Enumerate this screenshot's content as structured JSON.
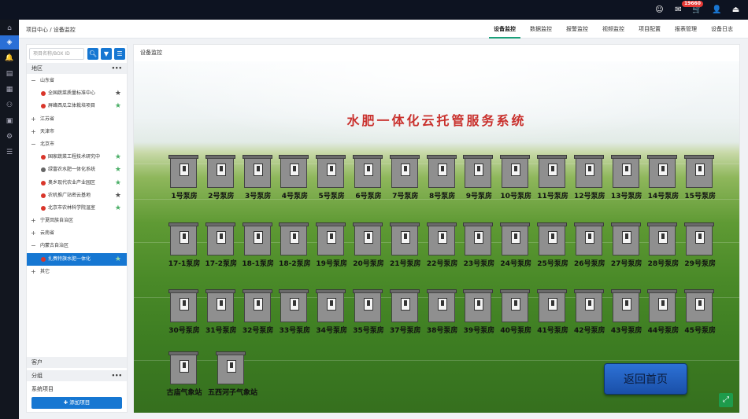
{
  "topbar": {
    "badge": "19660",
    "icons": [
      "smiley-icon",
      "mail-icon",
      "cart-icon",
      "user-icon",
      "logout-icon"
    ]
  },
  "rail": {
    "icons": [
      "home-icon",
      "layers-icon",
      "alert-icon",
      "clipboard-icon",
      "grid-icon",
      "person-icon",
      "bus-icon",
      "settings-icon",
      "database-icon"
    ]
  },
  "header": {
    "breadcrumb": "项目中心 / 设备监控",
    "tabs": [
      "设备监控",
      "数据监控",
      "报警监控",
      "视频监控",
      "项目配置",
      "报表管理",
      "设备日志"
    ],
    "active_tab": "设备监控"
  },
  "sidebar": {
    "search_placeholder": "项目名称/BOX ID",
    "section_region": "地区",
    "more": "•••",
    "tree": [
      {
        "type": "group",
        "toggle": "−",
        "label": "山东省"
      },
      {
        "type": "leaf",
        "label": "全国蔬菜质量标准中心",
        "dot": "#d9362b",
        "star": "#555555"
      },
      {
        "type": "leaf",
        "label": "屏峰西瓜立体栽培项目",
        "dot": "#d9362b",
        "star": "#4caf68"
      },
      {
        "type": "group",
        "toggle": "+",
        "label": "江苏省"
      },
      {
        "type": "group",
        "toggle": "+",
        "label": "天津市"
      },
      {
        "type": "group",
        "toggle": "−",
        "label": "北京市"
      },
      {
        "type": "leaf",
        "label": "国家蔬菜工程技术研究中",
        "dot": "#d9362b",
        "star": "#4caf68"
      },
      {
        "type": "leaf",
        "label": "绿富农水肥一体化系统",
        "dot": "#666666",
        "star": "#4caf68"
      },
      {
        "type": "leaf",
        "label": "奥乡现代农业产业园区",
        "dot": "#d9362b",
        "star": "#4caf68"
      },
      {
        "type": "leaf",
        "label": "农机推广站密云基地",
        "dot": "#d9362b",
        "star": "#555555"
      },
      {
        "type": "leaf",
        "label": "北京市农林科学院温室",
        "dot": "#d9362b",
        "star": "#4caf68"
      },
      {
        "type": "group",
        "toggle": "+",
        "label": "宁夏回族自治区"
      },
      {
        "type": "group",
        "toggle": "+",
        "label": "云南省"
      },
      {
        "type": "group",
        "toggle": "−",
        "label": "内蒙古自治区"
      },
      {
        "type": "leaf",
        "label": "扎赉特旗水肥一体化",
        "dot": "#d9362b",
        "star": "#4caf68",
        "selected": true
      },
      {
        "type": "group",
        "toggle": "+",
        "label": "其它"
      }
    ],
    "section_customer": "客户",
    "section_group": "分组",
    "section_system": "系统项目",
    "add_button": "✚ 添加项目"
  },
  "main": {
    "title": "设备监控",
    "scene_title": "水肥一体化云托管服务系统",
    "back_button": "返回首页",
    "stations": [
      "1号泵房",
      "2号泵房",
      "3号泵房",
      "4号泵房",
      "5号泵房",
      "6号泵房",
      "7号泵房",
      "8号泵房",
      "9号泵房",
      "10号泵房",
      "11号泵房",
      "12号泵房",
      "13号泵房",
      "14号泵房",
      "15号泵房",
      "17-1泵房",
      "17-2泵房",
      "18-1泵房",
      "18-2泵房",
      "19号泵房",
      "20号泵房",
      "21号泵房",
      "22号泵房",
      "23号泵房",
      "24号泵房",
      "25号泵房",
      "26号泵房",
      "27号泵房",
      "28号泵房",
      "29号泵房",
      "30号泵房",
      "31号泵房",
      "32号泵房",
      "33号泵房",
      "34号泵房",
      "35号泵房",
      "37号泵房",
      "38号泵房",
      "39号泵房",
      "40号泵房",
      "41号泵房",
      "42号泵房",
      "43号泵房",
      "44号泵房",
      "45号泵房",
      "古庙气象站",
      "五西河子气象站"
    ]
  }
}
